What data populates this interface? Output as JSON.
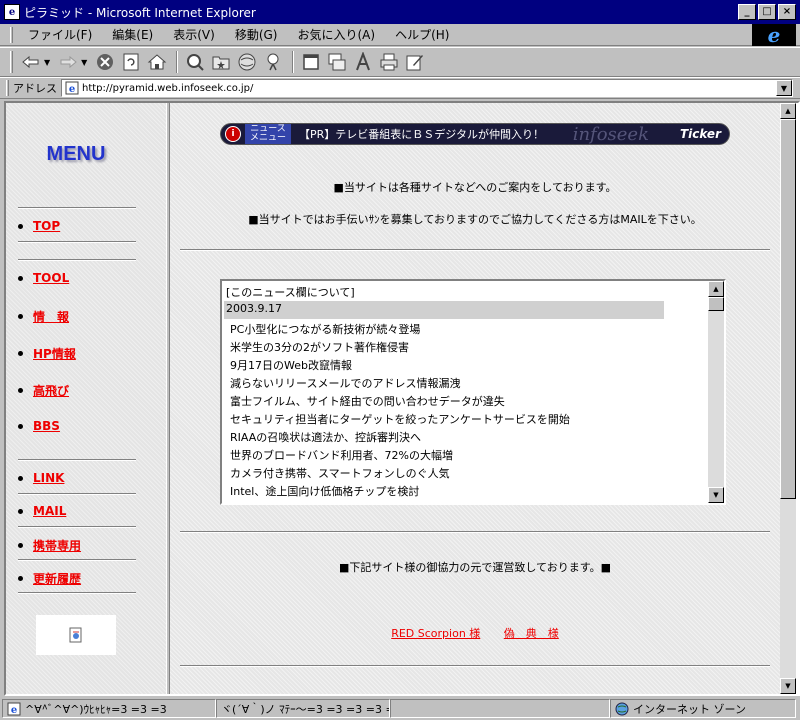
{
  "window": {
    "title": "ピラミッド - Microsoft Internet Explorer",
    "minimize": "_",
    "maximize": "□",
    "close": "×"
  },
  "menubar": [
    "ファイル(F)",
    "編集(E)",
    "表示(V)",
    "移動(G)",
    "お気に入り(A)",
    "ヘルプ(H)"
  ],
  "ie_logo": "e",
  "address": {
    "label": "アドレス",
    "url": "http://pyramid.web.infoseek.co.jp/"
  },
  "left_menu": {
    "title": "MENU",
    "groups": [
      [
        "TOP"
      ],
      [
        "TOOL",
        "情　報",
        "HP情報",
        "高飛び",
        "BBS"
      ],
      [
        "LINK",
        "MAIL",
        "携帯専用",
        "更新履歴"
      ]
    ]
  },
  "ticker": {
    "icon": "i",
    "label_line1": "ニュース",
    "label_line2": "メニュー",
    "text": "【PR】テレビ番組表にＢＳデジタルが仲間入り！",
    "brand": "infoseek",
    "tag": "Ticker"
  },
  "main": {
    "info_1": "■当サイトは各種サイトなどへのご案内をしております。",
    "info_2": "■当サイトではお手伝いｻﾝを募集しておりますのでご協力してくださる方はMAILを下さい。",
    "news_header": "[このニュース欄について]",
    "news_date": "2003.9.17",
    "news_items": [
      "PC小型化につながる新技術が続々登場",
      "米学生の3分の2がソフト著作権侵害",
      "9月17日のWeb改竄情報",
      "減らないリリースメールでのアドレス情報漏洩",
      "富士フイルム、サイト経由での問い合わせデータが違失",
      "セキュリティ担当者にターゲットを絞ったアンケートサービスを開始",
      "RIAAの召喚状は適法か、控訴審判決へ",
      "世界のブロードバンド利用者、72%の大幅増",
      "カメラ付き携帯、スマートフォンしのぐ人気",
      "Intel、途上国向け低価格チップを検討"
    ],
    "credits_title": "■下記サイト様の御協力の元で運営致しております。■",
    "credit_links": [
      "RED Scorpion 様",
      "偽　典　様"
    ]
  },
  "statusbar": {
    "left": "^∀^ﾞ^∀^)ｳﾋｬﾋｬ=3 =3 =3",
    "middle": "ヾ(´∀｀)ノ ﾏﾃｰ～=3 =3 =3 =3 =3",
    "zone": "インターネット ゾーン"
  }
}
